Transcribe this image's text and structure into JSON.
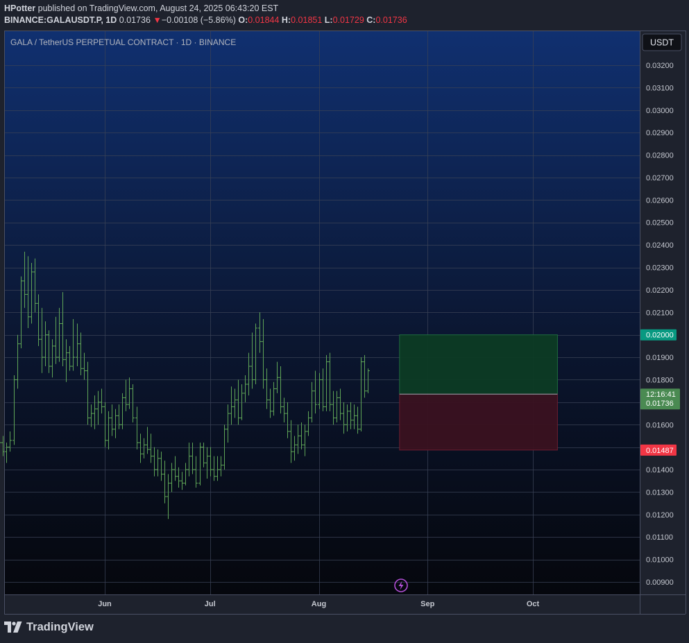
{
  "header": {
    "publisher": "HPotter",
    "published_text": "published on TradingView.com, August 24, 2025 06:43:20 EST",
    "symbol": "BINANCE:GALAUSDT.P, 1D",
    "last": "0.01736",
    "change_arrow": "▼",
    "change": "−0.00108 (−5.86%)",
    "o_label": "O:",
    "o": "0.01844",
    "h_label": "H:",
    "h": "0.01851",
    "l_label": "L:",
    "l": "0.01729",
    "c_label": "C:",
    "c": "0.01736"
  },
  "chart_title": "GALA / TetherUS PERPETUAL CONTRACT · 1D · BINANCE",
  "currency_button": "USDT",
  "countdown": "12:16:41",
  "footer_brand": "TradingView",
  "colors": {
    "bar": "#5fa557",
    "up_zone": "#0d3b24",
    "down_zone": "#3a1220",
    "target_label": "#089981",
    "stop_label": "#f23645",
    "price_label": "#4caf50"
  },
  "chart_data": {
    "type": "ohlc",
    "title": "GALA / TetherUS PERPETUAL CONTRACT · 1D · BINANCE",
    "ylim": [
      0.0085,
      0.033
    ],
    "y_ticks": [
      "0.03200",
      "0.03100",
      "0.03000",
      "0.02900",
      "0.02800",
      "0.02700",
      "0.02600",
      "0.02500",
      "0.02400",
      "0.02300",
      "0.02200",
      "0.02100",
      "0.02000",
      "0.01900",
      "0.01800",
      "0.01700",
      "0.01600",
      "0.01500",
      "0.01400",
      "0.01300",
      "0.01200",
      "0.01100",
      "0.01000",
      "0.00900"
    ],
    "x_ticks": [
      {
        "label": "Jun",
        "date": "2025-06-01"
      },
      {
        "label": "Jul",
        "date": "2025-07-01"
      },
      {
        "label": "Aug",
        "date": "2025-08-01"
      },
      {
        "label": "Sep",
        "date": "2025-09-01"
      },
      {
        "label": "Oct",
        "date": "2025-10-01"
      }
    ],
    "x_start": "2025-05-01",
    "x_end": "2025-10-31",
    "first_bar": "2025-05-01",
    "bars": [
      [
        0.0156,
        0.0157,
        0.0151,
        0.0154
      ],
      [
        0.0154,
        0.0158,
        0.0149,
        0.0152
      ],
      [
        0.0152,
        0.0155,
        0.0146,
        0.0148
      ],
      [
        0.0148,
        0.0152,
        0.0143,
        0.015
      ],
      [
        0.015,
        0.0157,
        0.0148,
        0.0153
      ],
      [
        0.0153,
        0.0182,
        0.0151,
        0.018
      ],
      [
        0.018,
        0.02,
        0.0176,
        0.0196
      ],
      [
        0.0196,
        0.0226,
        0.0194,
        0.0224
      ],
      [
        0.0224,
        0.0237,
        0.0212,
        0.0218
      ],
      [
        0.0218,
        0.0235,
        0.0203,
        0.0208
      ],
      [
        0.0208,
        0.0232,
        0.0205,
        0.0228
      ],
      [
        0.0228,
        0.0234,
        0.021,
        0.0214
      ],
      [
        0.0214,
        0.0218,
        0.0195,
        0.0198
      ],
      [
        0.0198,
        0.0212,
        0.0183,
        0.019
      ],
      [
        0.019,
        0.0206,
        0.0186,
        0.02
      ],
      [
        0.02,
        0.0202,
        0.0183,
        0.0186
      ],
      [
        0.0186,
        0.0198,
        0.0181,
        0.0195
      ],
      [
        0.0195,
        0.0208,
        0.0187,
        0.019
      ],
      [
        0.019,
        0.0212,
        0.0188,
        0.0205
      ],
      [
        0.0205,
        0.0219,
        0.0186,
        0.0189
      ],
      [
        0.0189,
        0.0198,
        0.0179,
        0.0192
      ],
      [
        0.0192,
        0.0195,
        0.0184,
        0.0186
      ],
      [
        0.0186,
        0.0207,
        0.0184,
        0.019
      ],
      [
        0.019,
        0.0205,
        0.0186,
        0.0196
      ],
      [
        0.0196,
        0.0201,
        0.0182,
        0.0185
      ],
      [
        0.0185,
        0.0192,
        0.018,
        0.0184
      ],
      [
        0.0184,
        0.0188,
        0.016,
        0.0163
      ],
      [
        0.0163,
        0.0169,
        0.0159,
        0.0165
      ],
      [
        0.0165,
        0.0173,
        0.0158,
        0.0167
      ],
      [
        0.0167,
        0.0175,
        0.016,
        0.017
      ],
      [
        0.017,
        0.0176,
        0.0165,
        0.0168
      ],
      [
        0.0168,
        0.017,
        0.015,
        0.0153
      ],
      [
        0.0153,
        0.0166,
        0.0149,
        0.0163
      ],
      [
        0.0163,
        0.0169,
        0.0155,
        0.0158
      ],
      [
        0.0158,
        0.0167,
        0.0154,
        0.0164
      ],
      [
        0.0164,
        0.0169,
        0.0158,
        0.016
      ],
      [
        0.016,
        0.0174,
        0.0158,
        0.0172
      ],
      [
        0.0172,
        0.018,
        0.0166,
        0.0169
      ],
      [
        0.0169,
        0.0181,
        0.0167,
        0.0176
      ],
      [
        0.0176,
        0.0178,
        0.0161,
        0.0163
      ],
      [
        0.0163,
        0.0168,
        0.0149,
        0.0152
      ],
      [
        0.0152,
        0.0156,
        0.0143,
        0.0147
      ],
      [
        0.0147,
        0.0154,
        0.0145,
        0.0151
      ],
      [
        0.0151,
        0.0159,
        0.0147,
        0.0149
      ],
      [
        0.0149,
        0.0156,
        0.0143,
        0.0146
      ],
      [
        0.0146,
        0.015,
        0.0137,
        0.014
      ],
      [
        0.014,
        0.0149,
        0.0137,
        0.0145
      ],
      [
        0.0145,
        0.0148,
        0.0135,
        0.0138
      ],
      [
        0.0138,
        0.0144,
        0.0125,
        0.0128
      ],
      [
        0.0128,
        0.0138,
        0.0118,
        0.0134
      ],
      [
        0.0134,
        0.0143,
        0.013,
        0.014
      ],
      [
        0.014,
        0.0146,
        0.0135,
        0.0137
      ],
      [
        0.0137,
        0.0141,
        0.0132,
        0.0135
      ],
      [
        0.0135,
        0.0139,
        0.0131,
        0.0134
      ],
      [
        0.0134,
        0.0143,
        0.0133,
        0.014
      ],
      [
        0.014,
        0.0152,
        0.0137,
        0.0146
      ],
      [
        0.0146,
        0.0152,
        0.0138,
        0.014
      ],
      [
        0.014,
        0.0146,
        0.0132,
        0.0134
      ],
      [
        0.0134,
        0.0152,
        0.0133,
        0.015
      ],
      [
        0.015,
        0.0152,
        0.0141,
        0.0143
      ],
      [
        0.0143,
        0.015,
        0.0136,
        0.0146
      ],
      [
        0.0146,
        0.015,
        0.0137,
        0.014
      ],
      [
        0.014,
        0.0146,
        0.0135,
        0.0137
      ],
      [
        0.0137,
        0.0146,
        0.0135,
        0.014
      ],
      [
        0.014,
        0.0146,
        0.0137,
        0.0142
      ],
      [
        0.0142,
        0.016,
        0.014,
        0.0158
      ],
      [
        0.0158,
        0.0169,
        0.0152,
        0.0165
      ],
      [
        0.0165,
        0.0177,
        0.016,
        0.0168
      ],
      [
        0.0168,
        0.0176,
        0.0163,
        0.0171
      ],
      [
        0.0171,
        0.018,
        0.016,
        0.0163
      ],
      [
        0.0163,
        0.0178,
        0.0162,
        0.0174
      ],
      [
        0.0174,
        0.0182,
        0.017,
        0.0178
      ],
      [
        0.0178,
        0.0192,
        0.0173,
        0.0186
      ],
      [
        0.0186,
        0.0201,
        0.0176,
        0.018
      ],
      [
        0.018,
        0.0205,
        0.0178,
        0.0203
      ],
      [
        0.0203,
        0.021,
        0.0192,
        0.0197
      ],
      [
        0.0197,
        0.0207,
        0.0176,
        0.018
      ],
      [
        0.018,
        0.0185,
        0.0167,
        0.0171
      ],
      [
        0.0171,
        0.0176,
        0.0163,
        0.0166
      ],
      [
        0.0166,
        0.0179,
        0.0164,
        0.0176
      ],
      [
        0.0176,
        0.0188,
        0.0174,
        0.0181
      ],
      [
        0.0181,
        0.0186,
        0.0165,
        0.0168
      ],
      [
        0.0168,
        0.0172,
        0.0161,
        0.0165
      ],
      [
        0.0165,
        0.017,
        0.0154,
        0.0157
      ],
      [
        0.0157,
        0.0162,
        0.0143,
        0.0148
      ],
      [
        0.0148,
        0.0155,
        0.0144,
        0.0151
      ],
      [
        0.0151,
        0.016,
        0.0147,
        0.0155
      ],
      [
        0.0155,
        0.0161,
        0.0149,
        0.0151
      ],
      [
        0.0151,
        0.016,
        0.0146,
        0.0157
      ],
      [
        0.0157,
        0.0166,
        0.0155,
        0.0163
      ],
      [
        0.0163,
        0.0179,
        0.0161,
        0.0175
      ],
      [
        0.0175,
        0.0184,
        0.0165,
        0.0169
      ],
      [
        0.0169,
        0.0183,
        0.0167,
        0.018
      ],
      [
        0.018,
        0.0185,
        0.0166,
        0.0168
      ],
      [
        0.0168,
        0.0191,
        0.0166,
        0.0188
      ],
      [
        0.0188,
        0.0192,
        0.0166,
        0.0169
      ],
      [
        0.0169,
        0.0175,
        0.016,
        0.0163
      ],
      [
        0.0163,
        0.0175,
        0.0161,
        0.0172
      ],
      [
        0.0172,
        0.0176,
        0.0162,
        0.0165
      ],
      [
        0.0165,
        0.017,
        0.0156,
        0.016
      ],
      [
        0.016,
        0.0169,
        0.0157,
        0.0166
      ],
      [
        0.0166,
        0.017,
        0.0158,
        0.0162
      ],
      [
        0.0162,
        0.0169,
        0.0158,
        0.0164
      ],
      [
        0.0164,
        0.0168,
        0.0156,
        0.0158
      ],
      [
        0.0158,
        0.019,
        0.0157,
        0.0188
      ],
      [
        0.0188,
        0.0191,
        0.0172,
        0.0175
      ],
      [
        0.0175,
        0.0185,
        0.0174,
        0.0184
      ]
    ],
    "target_zone": {
      "top": 0.02,
      "entry": 0.01736,
      "stop": 0.01487,
      "start_date": "2025-08-24",
      "end_date": "2025-10-08"
    },
    "price_labels": {
      "target": "0.02000",
      "current": "0.01736",
      "stop": "0.01487"
    }
  }
}
